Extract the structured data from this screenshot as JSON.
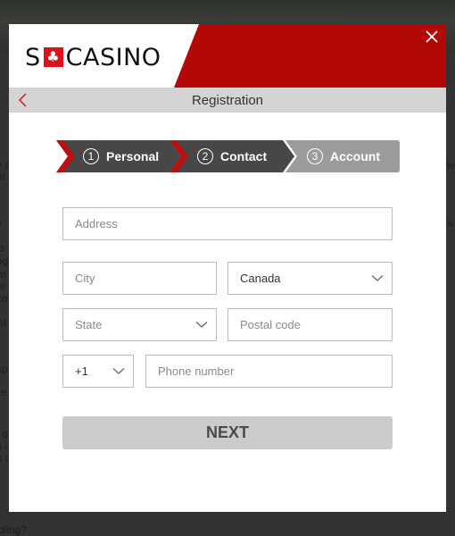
{
  "background": {
    "left_fragments": [
      "y a",
      "ar",
      "y",
      "o",
      "og",
      "wi",
      "er",
      "co",
      "wi",
      "sp",
      "f e",
      "g",
      "s i",
      "s a"
    ],
    "right_fragments": [
      "le",
      "s"
    ],
    "bottom_text": "bling?"
  },
  "modal": {
    "logo": {
      "prefix": "S",
      "flag_symbol": "♣",
      "suffix": "CASINO"
    },
    "header_title": "Registration",
    "colors": {
      "brand_red": "#b30808",
      "step_active": "#474747",
      "step_inactive": "#9b9b9b",
      "step_accent": "#c00d0d"
    },
    "steps": [
      {
        "number": "1",
        "label": "Personal",
        "state": "completed"
      },
      {
        "number": "2",
        "label": "Contact",
        "state": "current"
      },
      {
        "number": "3",
        "label": "Account",
        "state": "upcoming"
      }
    ],
    "form": {
      "address": {
        "placeholder": "Address",
        "value": ""
      },
      "city": {
        "placeholder": "City",
        "value": ""
      },
      "country": {
        "selected": "Canada"
      },
      "state": {
        "selected": "State"
      },
      "postal_code": {
        "placeholder": "Postal code",
        "value": ""
      },
      "phone_code": {
        "selected": "+1"
      },
      "phone_number": {
        "placeholder": "Phone number",
        "value": ""
      }
    },
    "next_button": "NEXT"
  }
}
